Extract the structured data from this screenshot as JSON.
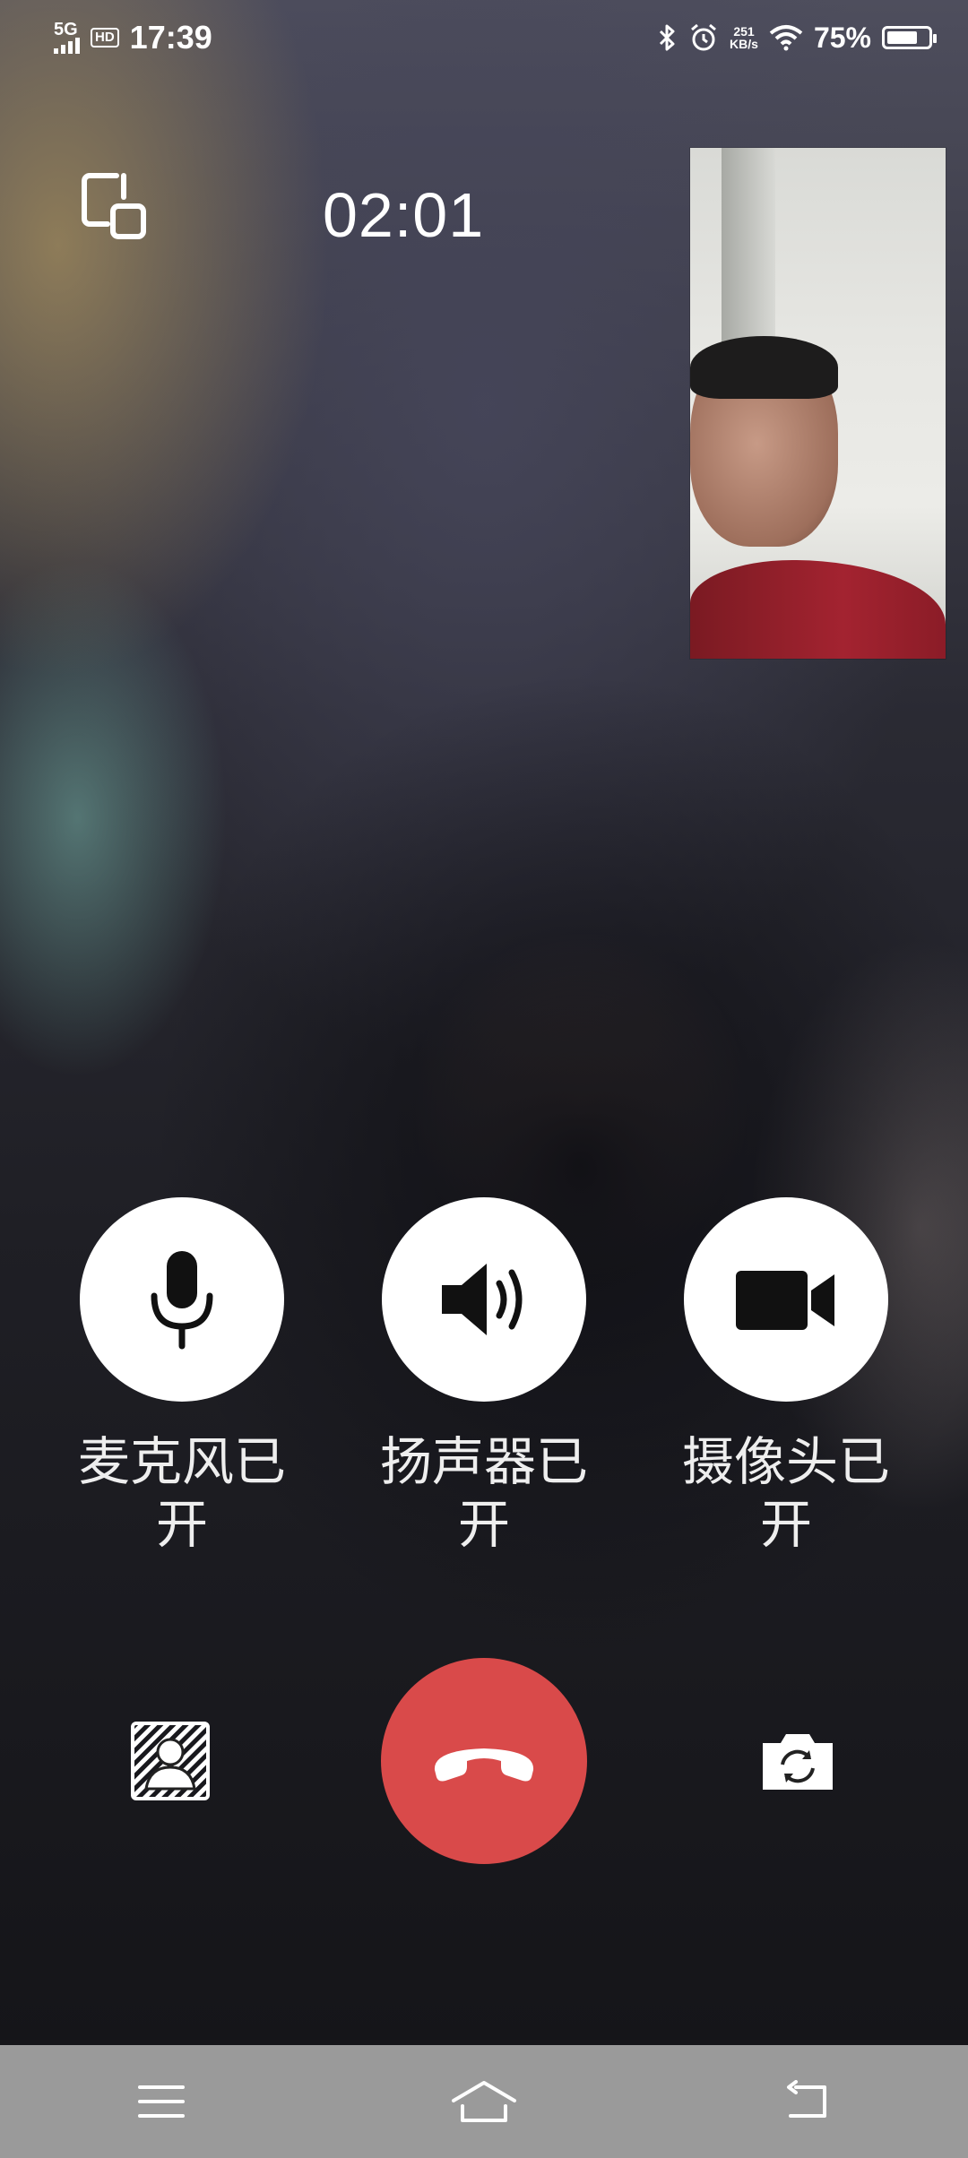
{
  "status_bar": {
    "network": "5G",
    "hd": "HD",
    "time": "17:39",
    "speed_value": "251",
    "speed_unit": "KB/s",
    "battery_percent": "75%",
    "battery_level": 0.75
  },
  "call": {
    "timer": "02:01"
  },
  "controls": {
    "mic_label": "麦克风已开",
    "speaker_label": "扬声器已开",
    "camera_label": "摄像头已开"
  },
  "icons": {
    "switch_window": "switch-window-icon",
    "mic": "microphone-icon",
    "speaker": "speaker-icon",
    "camera": "video-camera-icon",
    "avatar": "avatar-blur-icon",
    "hangup": "hang-up-icon",
    "flip_camera": "flip-camera-icon",
    "menu": "menu-icon",
    "home": "home-icon",
    "back": "back-icon"
  },
  "colors": {
    "hangup": "#d94a4a",
    "control_bg": "#ffffff",
    "nav_bar": "#9a9a9a"
  }
}
